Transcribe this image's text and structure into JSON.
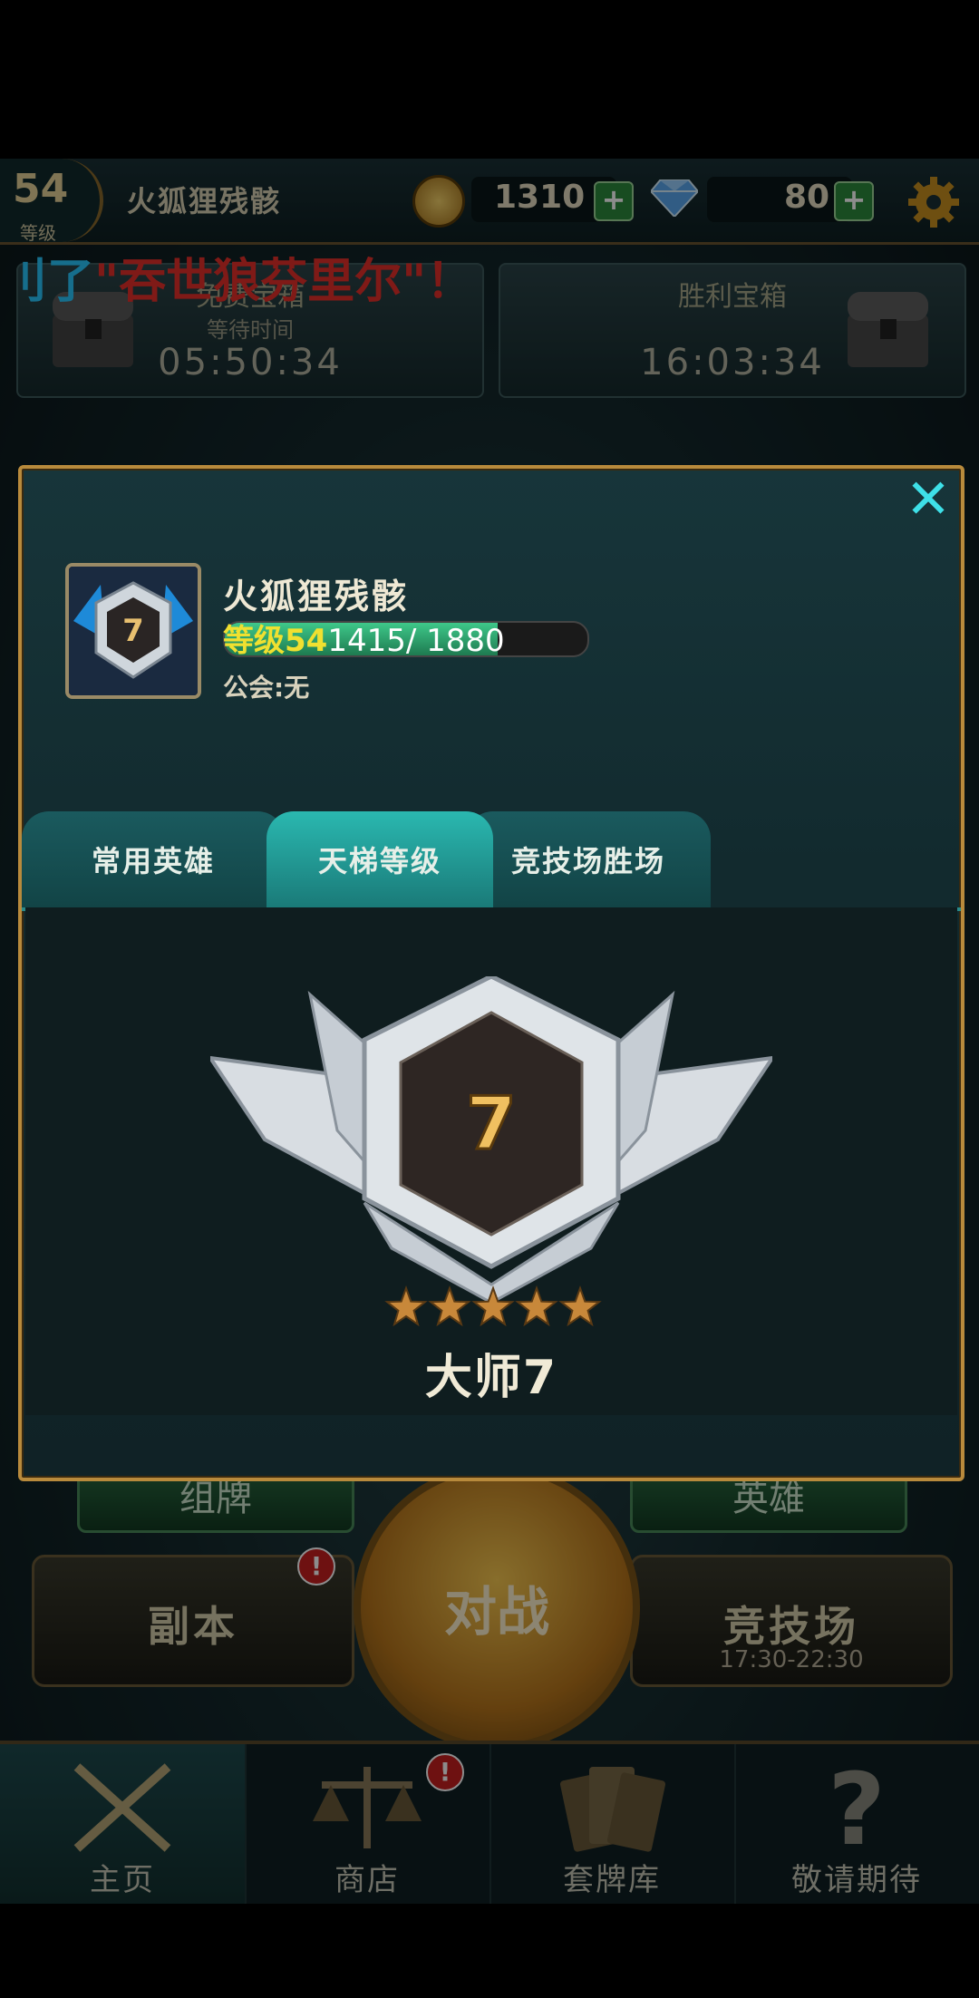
{
  "topbar": {
    "level": "54",
    "level_label": "等级",
    "player_name": "火狐狸残骸",
    "gold": "1310",
    "gems": "80",
    "plus": "+"
  },
  "marquee": {
    "prefix": "刂了",
    "text": "\"吞世狼芬里尔\"！"
  },
  "chests": {
    "free": {
      "title": "免费宝箱",
      "subtitle": "等待时间",
      "time": "05:50:34"
    },
    "victory": {
      "title": "胜利宝箱",
      "time": "16:03:34"
    }
  },
  "main": {
    "deck": "组牌",
    "heroes": "英雄",
    "battle": "对战",
    "dungeon": "副本",
    "arena": "竞技场",
    "arena_time": "17:30-22:30",
    "alert": "!"
  },
  "nav": [
    {
      "label": "主页",
      "icon": "crossed-swords-icon"
    },
    {
      "label": "商店",
      "icon": "scales-icon"
    },
    {
      "label": "套牌库",
      "icon": "cards-icon"
    },
    {
      "label": "敬请期待",
      "icon": "question-icon"
    }
  ],
  "profile": {
    "name": "火狐狸残骸",
    "level_text": "等级54",
    "xp_text": "1415/ 1880",
    "xp_current": 1415,
    "xp_max": 1880,
    "guild": "公会:无",
    "rank_number": "7",
    "close": "✕"
  },
  "tabs": [
    {
      "label": "常用英雄",
      "active": false
    },
    {
      "label": "天梯等级",
      "active": true
    },
    {
      "label": "竞技场胜场",
      "active": false
    }
  ],
  "rank": {
    "number": "7",
    "name": "大师7",
    "stars": 5
  },
  "colors": {
    "accent": "#3ee0e8",
    "gold_border": "#b88a3c",
    "xp_level": "#f0e030",
    "marquee": "#e8302a"
  }
}
